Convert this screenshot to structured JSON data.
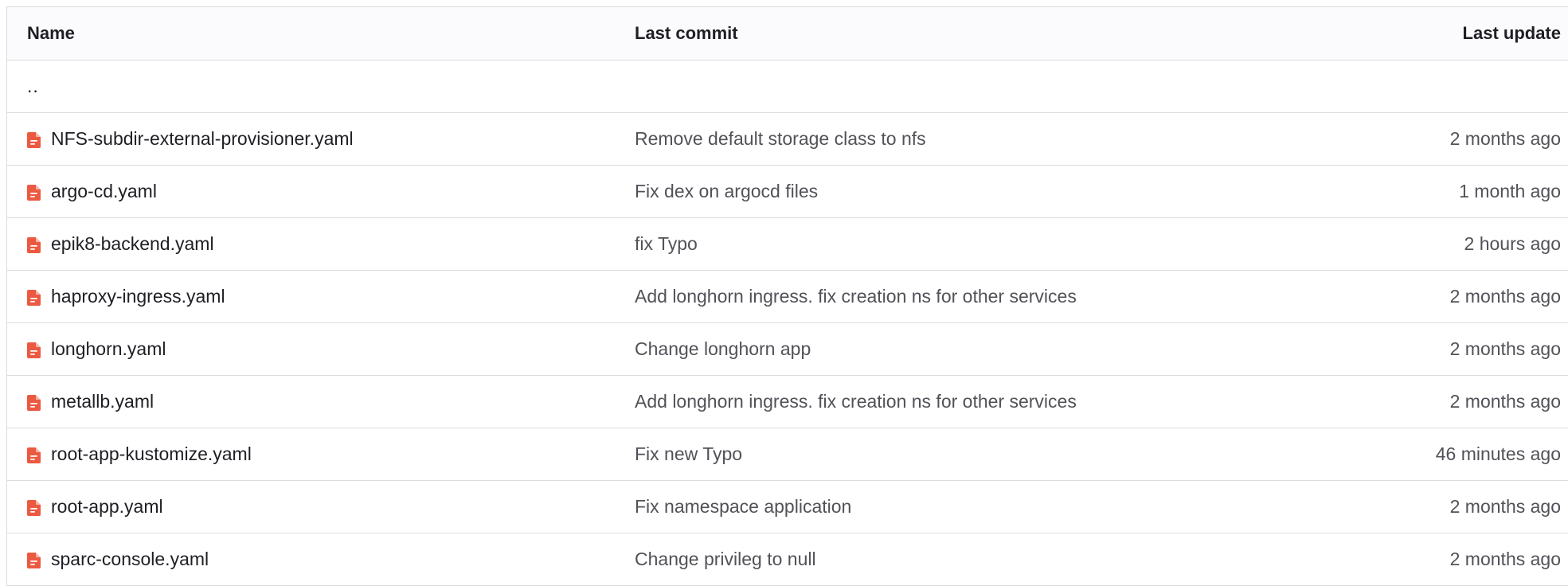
{
  "header": {
    "name": "Name",
    "last_commit": "Last commit",
    "last_update": "Last update"
  },
  "parent": {
    "label": ".."
  },
  "icon": {
    "file": "file-icon",
    "color": "#ec5941"
  },
  "files": [
    {
      "name": "NFS-subdir-external-provisioner.yaml",
      "commit": "Remove default storage class to nfs",
      "updated": "2 months ago"
    },
    {
      "name": "argo-cd.yaml",
      "commit": "Fix dex on argocd files",
      "updated": "1 month ago"
    },
    {
      "name": "epik8-backend.yaml",
      "commit": "fix Typo",
      "updated": "2 hours ago"
    },
    {
      "name": "haproxy-ingress.yaml",
      "commit": "Add longhorn ingress. fix creation ns for other services",
      "updated": "2 months ago"
    },
    {
      "name": "longhorn.yaml",
      "commit": "Change longhorn app",
      "updated": "2 months ago"
    },
    {
      "name": "metallb.yaml",
      "commit": "Add longhorn ingress. fix creation ns for other services",
      "updated": "2 months ago"
    },
    {
      "name": "root-app-kustomize.yaml",
      "commit": "Fix new Typo",
      "updated": "46 minutes ago"
    },
    {
      "name": "root-app.yaml",
      "commit": "Fix namespace application",
      "updated": "2 months ago"
    },
    {
      "name": "sparc-console.yaml",
      "commit": "Change privileg to null",
      "updated": "2 months ago"
    }
  ]
}
